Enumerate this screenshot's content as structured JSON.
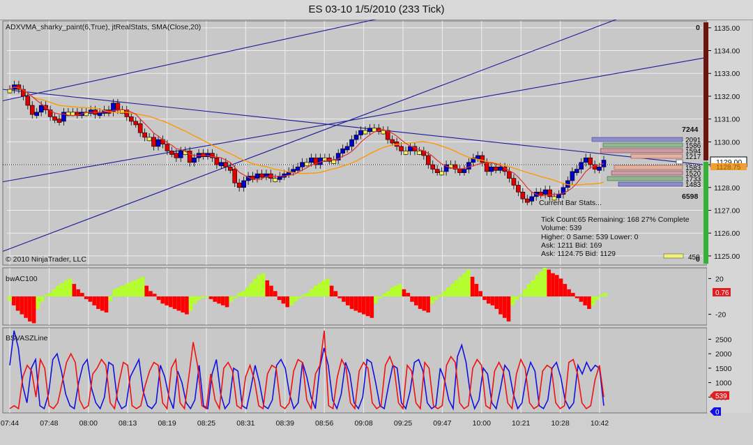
{
  "window": {
    "title": "ES 03-10  1/5/2010 (233 Tick)"
  },
  "panels": {
    "price": {
      "indicators_label": "ADXVMA_sharky_paint(6,True), jtRealStats, SMA(Close,20)",
      "copyright": "© 2010 NinjaTrader, LLC",
      "current_price": "1129.00",
      "secondary_price_tag": "1128.75",
      "volume_top_label": "0",
      "volume_bottom_label": "0",
      "ask_total": "7244",
      "bid_total": "6598",
      "ask_ladder": [
        "2091",
        "1586",
        "1594",
        "1217"
      ],
      "mid_row_value": "...",
      "bid_ladder": [
        "1583",
        "1520",
        "1733",
        "1483"
      ],
      "small_bar_value": "450",
      "bar_stats": {
        "heading": "Current Bar Stats...",
        "line1": "Tick Count:65  Remaining: 168  27% Complete",
        "line2": "Volume: 539",
        "line3": "Higher: 0   Same: 539   Lower: 0",
        "line4": "Ask:    1211        Bid:    169",
        "line5": "Ask: 1124.75  Bid: 1129"
      }
    },
    "osc": {
      "label": "bwAC100",
      "value_tag": "0.76"
    },
    "bsv": {
      "label": "BSVASZLine",
      "value_tag_red": "539",
      "value_tag_blue": "0"
    }
  },
  "colors": {
    "background": "#c8c8c8",
    "up_bar": "#0000cc",
    "down_bar": "#dd0000",
    "neutral_bar": "#f0f060",
    "trend_line": "#1a1a9a",
    "sma": "#ff9900",
    "adxvma": "#e03030",
    "osc_up": "#b4ff2a",
    "osc_down": "#ff0000",
    "line_blue": "#1010e0",
    "line_red": "#f01010"
  },
  "chart_data": [
    {
      "type": "candlestick",
      "x_tick_labels": [
        "07:44",
        "07:48",
        "08:00",
        "08:13",
        "08:19",
        "08:25",
        "08:31",
        "08:39",
        "08:56",
        "09:08",
        "09:25",
        "09:47",
        "10:00",
        "10:21",
        "10:28",
        "10:42"
      ],
      "y_tick_labels": [
        "1125.00",
        "1126.00",
        "1127.00",
        "1128.00",
        "1129.00",
        "1130.00",
        "1131.00",
        "1132.00",
        "1133.00",
        "1134.00",
        "1135.00"
      ],
      "ylim": [
        1124.6,
        1135.3
      ],
      "close": [
        1132.3,
        1132.5,
        1132.3,
        1132.0,
        1131.6,
        1131.2,
        1131.3,
        1131.6,
        1131.4,
        1131.1,
        1131.0,
        1130.9,
        1131.3,
        1131.3,
        1131.3,
        1131.2,
        1131.3,
        1131.3,
        1131.4,
        1131.2,
        1131.3,
        1131.4,
        1131.3,
        1131.7,
        1131.4,
        1131.4,
        1131.1,
        1130.9,
        1130.8,
        1130.4,
        1130.2,
        1130.2,
        1129.8,
        1130.1,
        1129.9,
        1129.6,
        1129.5,
        1129.3,
        1129.6,
        1129.6,
        1129.1,
        1129.3,
        1129.5,
        1129.4,
        1129.5,
        1129.3,
        1129.0,
        1129.1,
        1128.9,
        1128.8,
        1128.2,
        1128.0,
        1128.3,
        1128.5,
        1128.4,
        1128.6,
        1128.5,
        1128.6,
        1128.4,
        1128.4,
        1128.5,
        1128.6,
        1128.7,
        1128.8,
        1128.9,
        1129.1,
        1129.1,
        1129.3,
        1129.0,
        1129.3,
        1129.3,
        1129.2,
        1129.2,
        1129.5,
        1129.7,
        1129.8,
        1130.1,
        1130.3,
        1130.5,
        1130.5,
        1130.6,
        1130.6,
        1130.5,
        1130.5,
        1130.1,
        1130.0,
        1129.8,
        1129.6,
        1129.6,
        1129.8,
        1129.6,
        1129.6,
        1129.4,
        1129.0,
        1128.8,
        1128.7,
        1128.7,
        1129.0,
        1129.0,
        1128.8,
        1128.7,
        1128.8,
        1129.1,
        1129.3,
        1129.4,
        1129.1,
        1128.7,
        1128.9,
        1128.8,
        1128.9,
        1128.7,
        1128.4,
        1128.1,
        1127.8,
        1127.5,
        1127.4,
        1127.6,
        1127.8,
        1127.7,
        1127.9,
        1127.6,
        1127.6,
        1127.7,
        1128.0,
        1128.3,
        1128.7,
        1128.8,
        1129.1,
        1129.3,
        1129.0,
        1128.8,
        1128.9,
        1129.2
      ]
    },
    {
      "type": "bar",
      "name": "bwAC100",
      "ylim": [
        -32,
        32
      ],
      "y_tick_labels": [
        "20",
        "-20"
      ],
      "values": [
        -5,
        -10,
        -16,
        -20,
        -24,
        -28,
        -30,
        -14,
        -6,
        2,
        4,
        8,
        12,
        15,
        18,
        20,
        14,
        8,
        4,
        -3,
        -6,
        -10,
        -14,
        -16,
        -18,
        -5,
        8,
        10,
        12,
        14,
        16,
        18,
        20,
        22,
        12,
        6,
        3,
        -4,
        -8,
        -10,
        -12,
        -14,
        -16,
        -18,
        -20,
        -16,
        -8,
        -4,
        -2,
        -1,
        -3,
        -6,
        -8,
        -10,
        -12,
        -6,
        -2,
        4,
        6,
        10,
        15,
        20,
        24,
        26,
        18,
        12,
        6,
        -4,
        -8,
        -12,
        -10,
        -6,
        -2,
        2,
        4,
        8,
        12,
        15,
        18,
        20,
        12,
        6,
        -2,
        -6,
        -10,
        -14,
        -16,
        -18,
        -20,
        -22,
        -24,
        -8,
        -2,
        3,
        6,
        10,
        12,
        14,
        8,
        4,
        -6,
        -10,
        -14,
        -16,
        -18,
        -8,
        -4,
        2,
        6,
        10,
        14,
        18,
        22,
        26,
        30,
        22,
        14,
        6,
        -4,
        -8,
        -10,
        -14,
        -20,
        -24,
        -28,
        -10,
        -4,
        2,
        8,
        14,
        18,
        24,
        28,
        32,
        30,
        26,
        24,
        20,
        14,
        8,
        4,
        -2,
        -6,
        -10,
        -14,
        -10,
        -4,
        2,
        4
      ]
    },
    {
      "type": "line",
      "name": "BSVASZLine",
      "ylim": [
        0,
        2800
      ],
      "y_tick_labels": [
        "2500",
        "2000",
        "1500",
        "1000",
        "500"
      ],
      "series": [
        {
          "color": "blue",
          "values": [
            1600,
            2800,
            2200,
            900,
            300,
            1500,
            1800,
            200,
            100,
            600,
            1800,
            2000,
            1400,
            600,
            200,
            100,
            1000,
            1600,
            1800,
            800,
            300,
            100,
            500,
            1700,
            1600,
            400,
            100,
            200,
            1200,
            1500,
            1800,
            700,
            200,
            100,
            300,
            1600,
            1200,
            500,
            100,
            1400,
            1000,
            300,
            100,
            400,
            1600,
            200,
            100,
            1300,
            1800,
            600,
            100,
            300,
            1500,
            1400,
            200,
            100,
            800,
            1600,
            1000,
            200,
            100,
            400,
            1600,
            1800,
            1500,
            600,
            100,
            300,
            1700,
            1200,
            500,
            100,
            1500,
            2200,
            1600,
            400,
            100,
            600,
            1700,
            1300,
            300,
            100,
            500,
            1800,
            1700,
            1000,
            200,
            100,
            900,
            1600,
            1500,
            300,
            100,
            700,
            1700,
            1800,
            1400,
            300,
            100,
            200,
            1500,
            1100,
            400,
            100,
            1900,
            2300,
            1700,
            600,
            100,
            400,
            1500,
            1300,
            300,
            100,
            800,
            1600,
            1400,
            600,
            100,
            300,
            1200,
            1700,
            1400,
            200,
            100,
            400,
            1500,
            1700,
            1200,
            400,
            100,
            300,
            1600,
            1300,
            1700,
            1400,
            1600,
            1500,
            200
          ]
        },
        {
          "color": "red",
          "values": [
            100,
            200,
            100,
            1200,
            1600,
            1400,
            500,
            1800,
            1500,
            200,
            100,
            300,
            1000,
            1700,
            2000,
            1700,
            400,
            100,
            200,
            1300,
            1500,
            1800,
            1600,
            300,
            100,
            1000,
            1700,
            1600,
            200,
            100,
            200,
            900,
            1400,
            1700,
            1600,
            300,
            100,
            1500,
            1800,
            300,
            100,
            1200,
            2400,
            1600,
            200,
            100,
            1300,
            400,
            100,
            1500,
            1700,
            1400,
            200,
            100,
            1200,
            1600,
            1100,
            200,
            100,
            1300,
            1600,
            1500,
            200,
            100,
            300,
            1400,
            1800,
            1700,
            400,
            100,
            1300,
            1600,
            2800,
            200,
            100,
            1200,
            1800,
            1500,
            300,
            100,
            1400,
            1700,
            1500,
            300,
            100,
            200,
            1600,
            1900,
            1500,
            300,
            100,
            1600,
            1400,
            300,
            100,
            1700,
            1500,
            200,
            100,
            200,
            1600,
            1900,
            1700,
            300,
            100,
            200,
            1500,
            1800,
            1600,
            200,
            100,
            1400,
            1700,
            1400,
            300,
            100,
            1300,
            1800,
            1500,
            300,
            100,
            200,
            1400,
            1600,
            1500,
            300,
            100,
            200,
            1700,
            1800,
            1300,
            300,
            100,
            200,
            1100,
            1600,
            500
          ]
        }
      ]
    }
  ]
}
